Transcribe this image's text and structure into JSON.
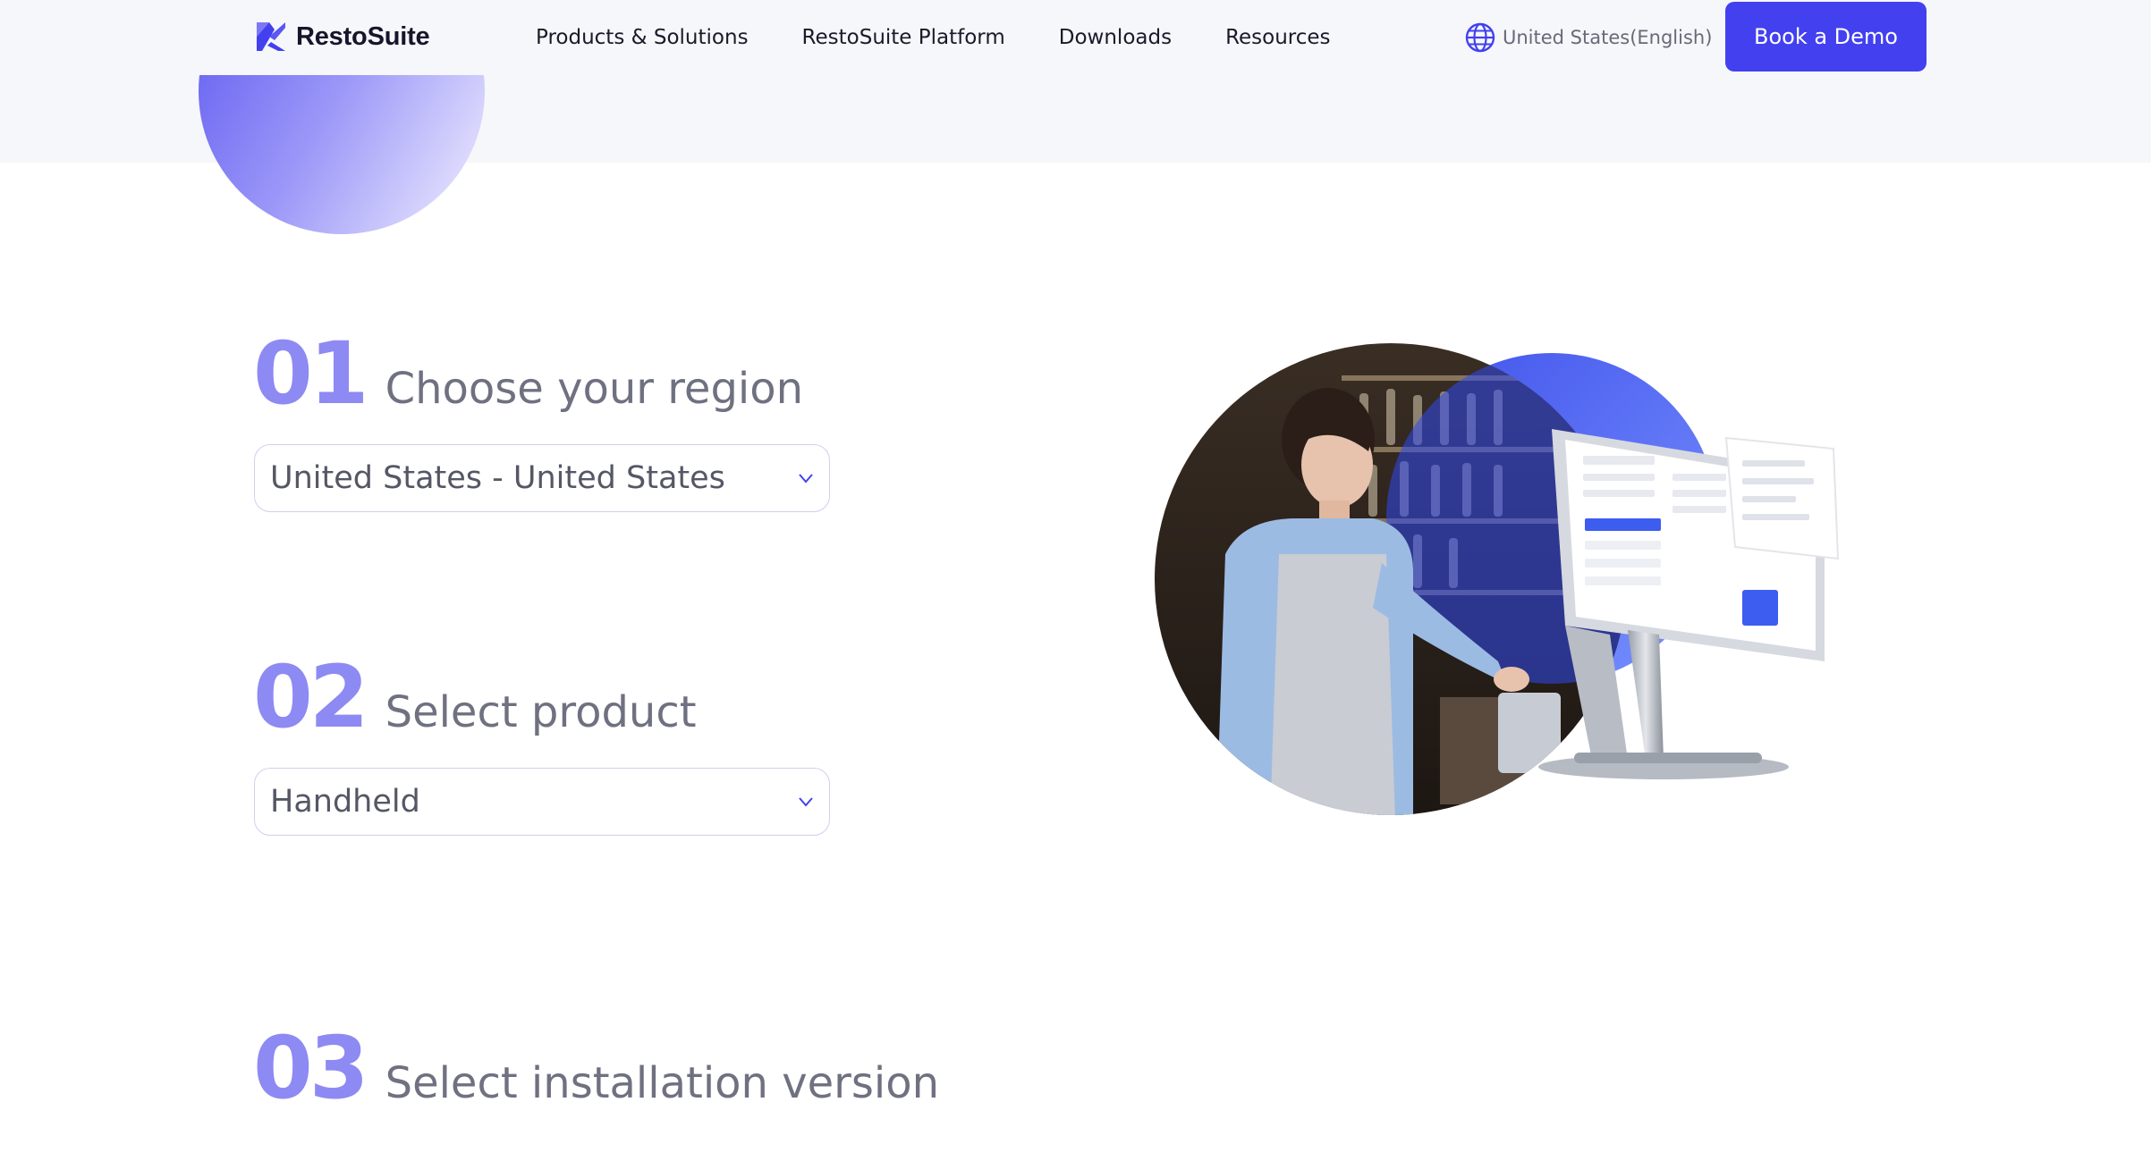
{
  "header": {
    "brand": "RestoSuite",
    "nav": [
      {
        "label": "Products & Solutions"
      },
      {
        "label": "RestoSuite Platform"
      },
      {
        "label": "Downloads"
      },
      {
        "label": "Resources"
      }
    ],
    "language": "United States(English)",
    "cta": "Book a Demo"
  },
  "steps": [
    {
      "number": "01",
      "title": "Choose your region",
      "selected": "United States - United States"
    },
    {
      "number": "02",
      "title": "Select product",
      "selected": "Handheld"
    },
    {
      "number": "03",
      "title": "Select installation version"
    }
  ],
  "icons": {
    "logo": "restosuite-logo-icon",
    "language": "globe-icon",
    "dropdown": "chevron-down-icon"
  },
  "colors": {
    "accent": "#4340f0",
    "step_number": "#8d8af3",
    "header_bg": "#f6f7fa"
  }
}
